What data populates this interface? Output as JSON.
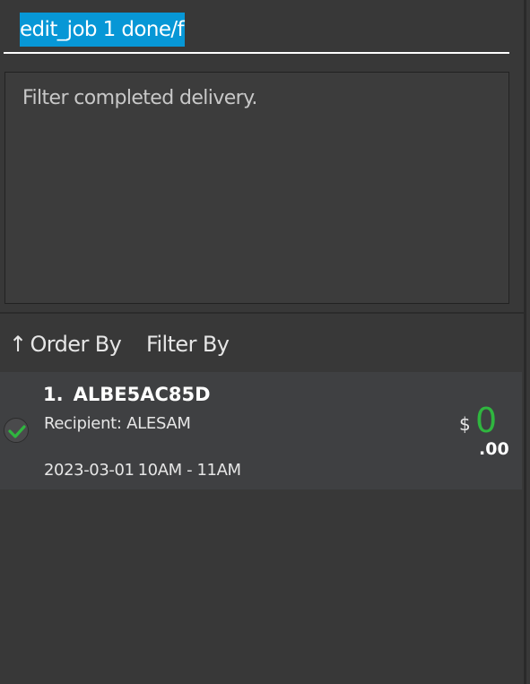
{
  "command_box": {
    "value": "edit_job 1 done/f"
  },
  "result_display": {
    "text": "Filter completed delivery."
  },
  "toolbar": {
    "sort_arrow": "↑",
    "order_by": "Order By",
    "filter_by": "Filter By"
  },
  "jobs": [
    {
      "index": "1.",
      "id": "ALBE5AC85D",
      "recipient": "Recipient: ALESAM",
      "date": "2023-03-01",
      "time_slot": "10AM - 11AM",
      "currency": "$",
      "earning_whole": "0",
      "earning_cents": ".00",
      "completed": true,
      "status_color": "#2fb63f"
    }
  ],
  "colors": {
    "background": "#383838",
    "selection": "#0797d6",
    "card": "#3f4042",
    "accent_green": "#2fb63f"
  }
}
